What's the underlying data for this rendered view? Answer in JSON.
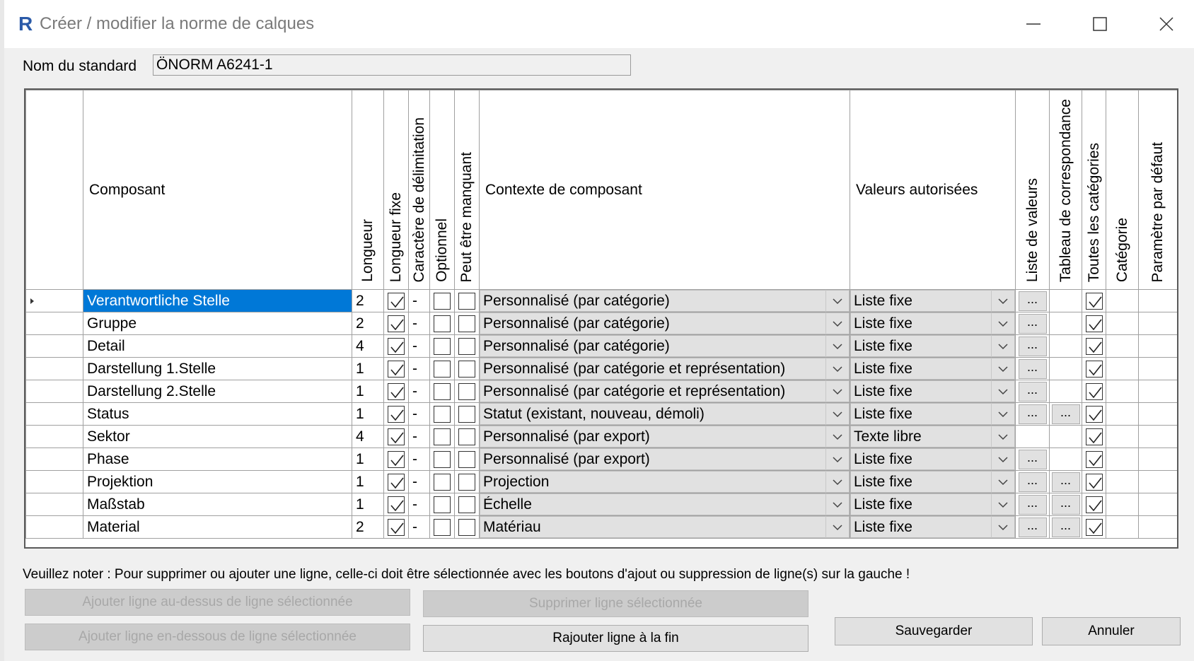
{
  "window": {
    "title": "Créer / modifier la norme de calques"
  },
  "standard": {
    "label": "Nom du standard",
    "value": "ÖNORM A6241-1"
  },
  "columns": {
    "component": "Composant",
    "length": "Longueur",
    "fixed_length": "Longueur fixe",
    "delimiter": "Caractère de délimitation",
    "optional": "Optionnel",
    "may_be_missing": "Peut être manquant",
    "context": "Contexte de composant",
    "allowed_values": "Valeurs autorisées",
    "value_list": "Liste de valeurs",
    "mapping_table": "Tableau de correspondance",
    "all_categories": "Toutes les catégories",
    "category": "Catégorie",
    "default_param": "Paramètre par défaut"
  },
  "rows": [
    {
      "component": "Verantwortliche Stelle",
      "length": "2",
      "fixed": true,
      "delimiter": "-",
      "optional": false,
      "missing": false,
      "context": "Personnalisé (par catégorie)",
      "allowed": "Liste fixe",
      "value_list_btn": "...",
      "mapping_btn": "",
      "all_cat": true,
      "selected": true
    },
    {
      "component": "Gruppe",
      "length": "2",
      "fixed": true,
      "delimiter": "-",
      "optional": false,
      "missing": false,
      "context": "Personnalisé (par catégorie)",
      "allowed": "Liste fixe",
      "value_list_btn": "...",
      "mapping_btn": "",
      "all_cat": true
    },
    {
      "component": "Detail",
      "length": "4",
      "fixed": true,
      "delimiter": "-",
      "optional": false,
      "missing": false,
      "context": "Personnalisé (par catégorie)",
      "allowed": "Liste fixe",
      "value_list_btn": "...",
      "mapping_btn": "",
      "all_cat": true
    },
    {
      "component": "Darstellung 1.Stelle",
      "length": "1",
      "fixed": true,
      "delimiter": "-",
      "optional": false,
      "missing": false,
      "context": "Personnalisé (par catégorie et représentation)",
      "allowed": "Liste fixe",
      "value_list_btn": "...",
      "mapping_btn": "",
      "all_cat": true
    },
    {
      "component": "Darstellung 2.Stelle",
      "length": "1",
      "fixed": true,
      "delimiter": "-",
      "optional": false,
      "missing": false,
      "context": "Personnalisé (par catégorie et représentation)",
      "allowed": "Liste fixe",
      "value_list_btn": "...",
      "mapping_btn": "",
      "all_cat": true
    },
    {
      "component": "Status",
      "length": "1",
      "fixed": true,
      "delimiter": "-",
      "optional": false,
      "missing": false,
      "context": "Statut (existant, nouveau, démoli)",
      "allowed": "Liste fixe",
      "value_list_btn": "...",
      "mapping_btn": "...",
      "all_cat": true
    },
    {
      "component": "Sektor",
      "length": "4",
      "fixed": true,
      "delimiter": "-",
      "optional": false,
      "missing": false,
      "context": "Personnalisé (par export)",
      "allowed": "Texte libre",
      "value_list_btn": "",
      "mapping_btn": "",
      "all_cat": true
    },
    {
      "component": "Phase",
      "length": "1",
      "fixed": true,
      "delimiter": "-",
      "optional": false,
      "missing": false,
      "context": "Personnalisé (par export)",
      "allowed": "Liste fixe",
      "value_list_btn": "...",
      "mapping_btn": "",
      "all_cat": true
    },
    {
      "component": "Projektion",
      "length": "1",
      "fixed": true,
      "delimiter": "-",
      "optional": false,
      "missing": false,
      "context": "Projection",
      "allowed": "Liste fixe",
      "value_list_btn": "...",
      "mapping_btn": "...",
      "all_cat": true
    },
    {
      "component": "Maßstab",
      "length": "1",
      "fixed": true,
      "delimiter": "-",
      "optional": false,
      "missing": false,
      "context": "Échelle",
      "allowed": "Liste fixe",
      "value_list_btn": "...",
      "mapping_btn": "...",
      "all_cat": true
    },
    {
      "component": "Material",
      "length": "2",
      "fixed": true,
      "delimiter": "-",
      "optional": false,
      "missing": false,
      "context": "Matériau",
      "allowed": "Liste fixe",
      "value_list_btn": "...",
      "mapping_btn": "...",
      "all_cat": true
    }
  ],
  "note": "Veuillez noter : Pour supprimer ou ajouter une ligne, celle-ci doit être sélectionnée avec les boutons d'ajout ou suppression de ligne(s) sur la gauche !",
  "buttons": {
    "add_above": "Ajouter ligne au-dessus de ligne sélectionnée",
    "add_below": "Ajouter ligne en-dessous de ligne sélectionnée",
    "delete": "Supprimer ligne sélectionnée",
    "append": "Rajouter ligne à la fin",
    "save": "Sauvegarder",
    "cancel": "Annuler"
  },
  "colors": {
    "selection": "#0078d7",
    "app_icon": "#2a5aa8"
  }
}
